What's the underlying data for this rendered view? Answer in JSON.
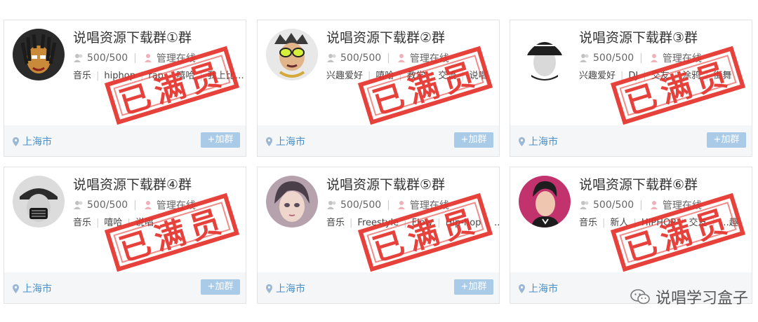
{
  "cards": [
    {
      "title": "说唱资源下载群①群",
      "members": "500/500",
      "admin": "管理在线",
      "tags": [
        "音乐",
        "hiphop",
        "rap",
        "嘻哈",
        "我上比…"
      ],
      "location": "上海市",
      "join_label": "+加群",
      "stamp": "已满员",
      "avatar_icon": "dreadlocks-portrait-icon"
    },
    {
      "title": "说唱资源下载群②群",
      "members": "500/500",
      "admin": "管理在线",
      "tags": [
        "兴趣爱好",
        "嘻哈",
        "教学",
        "交流",
        "说唱"
      ],
      "location": "上海市",
      "join_label": "+加群",
      "stamp": "已满员",
      "avatar_icon": "sunglasses-cartoon-icon"
    },
    {
      "title": "说唱资源下载群③群",
      "members": "500/500",
      "admin": "管理在线",
      "tags": [
        "兴趣爱好",
        "DJ",
        "交友",
        "涂鸦",
        "街舞"
      ],
      "location": "上海市",
      "join_label": "+加群",
      "stamp": "已满员",
      "avatar_icon": "cap-portrait-icon"
    },
    {
      "title": "说唱资源下载群④群",
      "members": "500/500",
      "admin": "管理在线",
      "tags": [
        "音乐",
        "嘻哈",
        "说唱"
      ],
      "location": "上海市",
      "join_label": "+加群",
      "stamp": "已满员",
      "avatar_icon": "masked-rapper-icon"
    },
    {
      "title": "说唱资源下载群⑤群",
      "members": "500/500",
      "admin": "管理在线",
      "tags": [
        "音乐",
        "Freestyle",
        "Flow",
        "Hip-hop",
        "…"
      ],
      "location": "上海市",
      "join_label": "+加群",
      "stamp": "已满员",
      "avatar_icon": "anime-girl-icon"
    },
    {
      "title": "说唱资源下载群⑥群",
      "members": "500/500",
      "admin": "管理在线",
      "tags": [
        "音乐",
        "新人",
        "HIPHOP",
        "交友",
        "…趣"
      ],
      "location": "上海市",
      "join_label": "+加群",
      "stamp": "已满员",
      "avatar_icon": "pink-portrait-icon"
    }
  ],
  "watermark": "说唱学习盒子",
  "colors": {
    "stamp_red": "#e5312c",
    "link_blue": "#4a90c8",
    "join_button": "#a9cbe8",
    "footer_bg": "#f5f6f7"
  }
}
